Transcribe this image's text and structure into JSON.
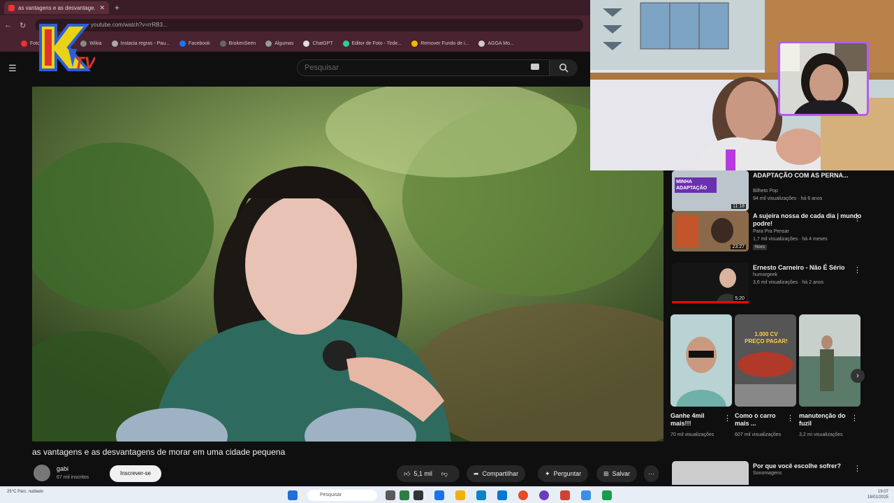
{
  "browser": {
    "tab_title": "as vantagens e as desvantage...",
    "address": "youtube.com/watch?v=rrRB3...",
    "bookmarks": [
      "Foto e canal - Yo...",
      "Wikia",
      "Instacia regras - Pau...",
      "Facebook",
      "BrokenSeen",
      "Algumas",
      "ChatGPT",
      "Editor de Foto - Tirde...",
      "Remover Fundo de i...",
      "AGGA Mo..."
    ]
  },
  "youtube": {
    "search_placeholder": "Pesquisar",
    "video_title": "as vantagens e as desvantagens de morar em uma cidade pequena",
    "channel_name": "gabi",
    "channel_subs": "67 mil inscritos",
    "subscribe_label": "Inscrever-se",
    "likes": "5,1 mil",
    "share_label": "Compartilhar",
    "ask_label": "Perguntar",
    "save_label": "Salvar",
    "more_label": "···"
  },
  "recommendations": [
    {
      "title": "ADAPTAÇÃO COM AS PERNA...",
      "channel": "Bilheto Pop",
      "meta": "94 mil visualizações · há 6 anos",
      "duration": "11:18",
      "thumb_text": "MINHA ADAPTAÇÃO",
      "badge": ""
    },
    {
      "title": "A sujeira nossa de cada dia | mundo podre!",
      "channel": "Para Pra Pensar",
      "meta": "1,7 mil visualizações · há 4 meses",
      "duration": "23:27",
      "thumb_text": "",
      "badge": "Novo"
    },
    {
      "title": "Ernesto Carneiro - Não É Sério",
      "channel": "humorgeek",
      "meta": "3,6 mil visualizações · há 2 anos",
      "duration": "5:20",
      "thumb_text": "",
      "badge": ""
    }
  ],
  "shorts": [
    {
      "title": "Ganhe 4mil mais!!!",
      "views": "70 mil visualizações"
    },
    {
      "title": "Como o carro mais ...",
      "views": "607 mil visualizações",
      "thumb_text": "1.000 CV PREÇO PAGAR!"
    },
    {
      "title": "manutenção do fuzil",
      "views": "3,2 mi visualizações"
    }
  ],
  "taskbar": {
    "weather": "25°C Parc. nublado",
    "search": "Pesquisar",
    "time": "19:07",
    "date": "18/01/2025"
  },
  "logo_text": "KTV",
  "colors": {
    "accent": "#ff0000",
    "pip_border": "#b35cf0",
    "browser": "#4a2330"
  }
}
